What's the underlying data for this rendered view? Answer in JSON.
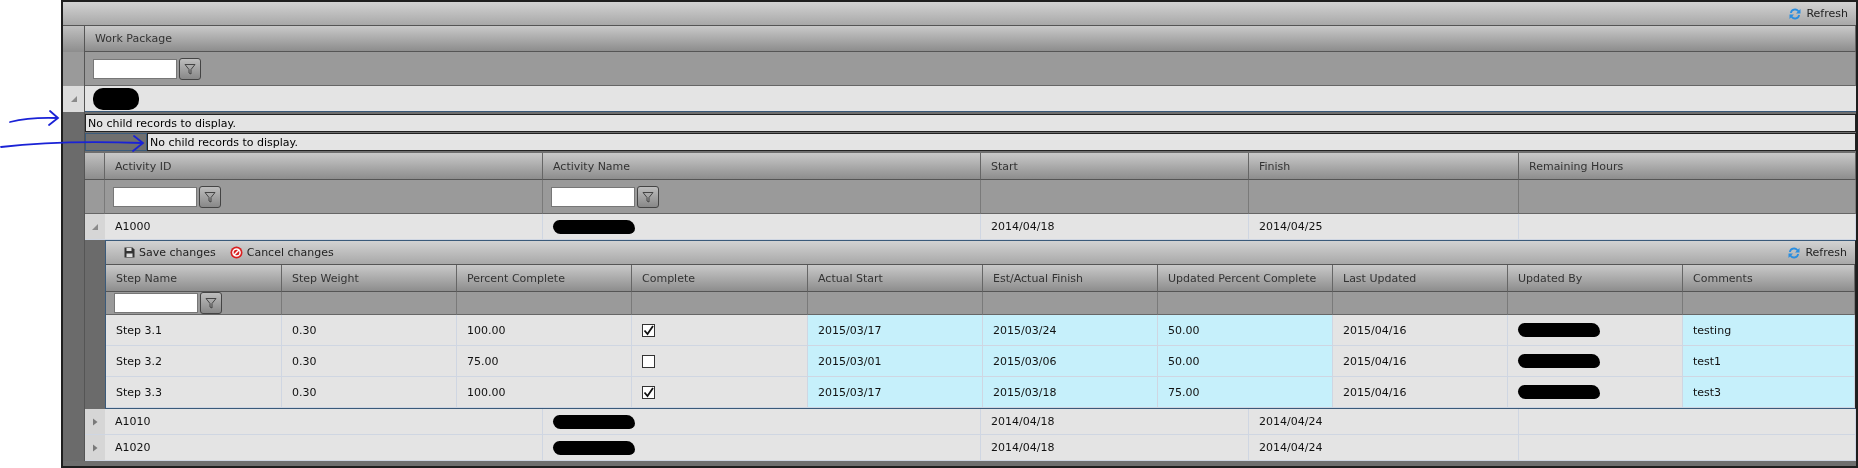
{
  "toolbar": {
    "refresh": "Refresh"
  },
  "work_package": {
    "header": "Work Package",
    "filterable": true
  },
  "group": {
    "expanded": true,
    "label_redacted": true
  },
  "no_child_messages": [
    "No child records to display.",
    "No child records to display."
  ],
  "activity_grid": {
    "columns": [
      {
        "label": "Activity ID",
        "filterable": true
      },
      {
        "label": "Activity Name",
        "filterable": true
      },
      {
        "label": "Start",
        "filterable": false
      },
      {
        "label": "Finish",
        "filterable": false
      },
      {
        "label": "Remaining Hours",
        "filterable": false
      }
    ],
    "rows": [
      {
        "expanded": true,
        "cells": [
          {
            "kind": "text",
            "text": "A1000"
          },
          {
            "kind": "redacted"
          },
          {
            "kind": "text",
            "text": "2014/04/18"
          },
          {
            "kind": "text",
            "text": "2014/04/25"
          }
        ],
        "steps": {
          "actions": [
            {
              "kind": "save",
              "label": "Save changes"
            },
            {
              "kind": "cancel",
              "label": "Cancel changes"
            }
          ],
          "refresh": "Refresh",
          "columns": [
            {
              "label": "Step Name",
              "filterable": true,
              "highlighted": false
            },
            {
              "label": "Step Weight",
              "filterable": false,
              "highlighted": false
            },
            {
              "label": "Percent Complete",
              "filterable": false,
              "highlighted": false
            },
            {
              "label": "Complete",
              "filterable": false,
              "highlighted": false
            },
            {
              "label": "Actual Start",
              "filterable": false,
              "highlighted": true
            },
            {
              "label": "Est/Actual Finish",
              "filterable": false,
              "highlighted": true
            },
            {
              "label": "Updated Percent Complete",
              "filterable": false,
              "highlighted": true
            },
            {
              "label": "Last Updated",
              "filterable": false,
              "highlighted": false
            },
            {
              "label": "Updated By",
              "filterable": false,
              "highlighted": false
            },
            {
              "label": "Comments",
              "filterable": false,
              "highlighted": true
            }
          ],
          "rows": [
            {
              "cells": [
                {
                  "kind": "text",
                  "text": "Step 3.1"
                },
                {
                  "kind": "text",
                  "text": "0.30"
                },
                {
                  "kind": "text",
                  "text": "100.00"
                },
                {
                  "kind": "checkbox",
                  "checked": true
                },
                {
                  "kind": "text",
                  "text": "2015/03/17"
                },
                {
                  "kind": "text",
                  "text": "2015/03/24"
                },
                {
                  "kind": "text",
                  "text": "50.00"
                },
                {
                  "kind": "text",
                  "text": "2015/04/16"
                },
                {
                  "kind": "redacted"
                },
                {
                  "kind": "text",
                  "text": "testing"
                }
              ]
            },
            {
              "cells": [
                {
                  "kind": "text",
                  "text": "Step 3.2"
                },
                {
                  "kind": "text",
                  "text": "0.30"
                },
                {
                  "kind": "text",
                  "text": "75.00"
                },
                {
                  "kind": "checkbox",
                  "checked": false
                },
                {
                  "kind": "text",
                  "text": "2015/03/01"
                },
                {
                  "kind": "text",
                  "text": "2015/03/06"
                },
                {
                  "kind": "text",
                  "text": "50.00"
                },
                {
                  "kind": "text",
                  "text": "2015/04/16"
                },
                {
                  "kind": "redacted"
                },
                {
                  "kind": "text",
                  "text": "test1"
                }
              ]
            },
            {
              "cells": [
                {
                  "kind": "text",
                  "text": "Step 3.3"
                },
                {
                  "kind": "text",
                  "text": "0.30"
                },
                {
                  "kind": "text",
                  "text": "100.00"
                },
                {
                  "kind": "checkbox",
                  "checked": true
                },
                {
                  "kind": "text",
                  "text": "2015/03/17"
                },
                {
                  "kind": "text",
                  "text": "2015/03/18"
                },
                {
                  "kind": "text",
                  "text": "75.00"
                },
                {
                  "kind": "text",
                  "text": "2015/04/16"
                },
                {
                  "kind": "redacted"
                },
                {
                  "kind": "text",
                  "text": "test3"
                }
              ]
            }
          ]
        }
      },
      {
        "expanded": false,
        "cells": [
          {
            "kind": "text",
            "text": "A1010"
          },
          {
            "kind": "redacted"
          },
          {
            "kind": "text",
            "text": "2014/04/18"
          },
          {
            "kind": "text",
            "text": "2014/04/24"
          }
        ]
      },
      {
        "expanded": false,
        "cells": [
          {
            "kind": "text",
            "text": "A1020"
          },
          {
            "kind": "redacted"
          },
          {
            "kind": "text",
            "text": "2014/04/18"
          },
          {
            "kind": "text",
            "text": "2014/04/24"
          }
        ]
      }
    ]
  }
}
